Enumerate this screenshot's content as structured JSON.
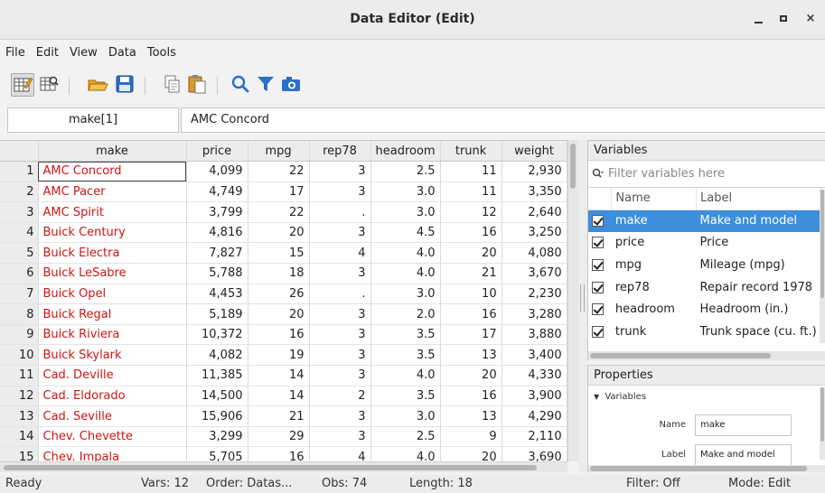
{
  "window": {
    "title": "Data Editor (Edit)"
  },
  "menu": [
    "File",
    "Edit",
    "View",
    "Data",
    "Tools"
  ],
  "toolbar": {
    "icons": [
      "edit-mode-icon",
      "browse-mode-icon",
      "open-folder-icon",
      "save-icon",
      "copy-icon",
      "paste-icon",
      "search-icon",
      "filter-icon",
      "snapshot-camera-icon"
    ]
  },
  "cell": {
    "ref": "make[1]",
    "value": "AMC Concord"
  },
  "grid": {
    "columns": [
      "make",
      "price",
      "mpg",
      "rep78",
      "headroom",
      "trunk",
      "weight"
    ],
    "rows": [
      {
        "n": "1",
        "make": "AMC Concord",
        "price": "4,099",
        "mpg": "22",
        "rep78": "3",
        "headroom": "2.5",
        "trunk": "11",
        "weight": "2,930"
      },
      {
        "n": "2",
        "make": "AMC Pacer",
        "price": "4,749",
        "mpg": "17",
        "rep78": "3",
        "headroom": "3.0",
        "trunk": "11",
        "weight": "3,350"
      },
      {
        "n": "3",
        "make": "AMC Spirit",
        "price": "3,799",
        "mpg": "22",
        "rep78": ".",
        "headroom": "3.0",
        "trunk": "12",
        "weight": "2,640"
      },
      {
        "n": "4",
        "make": "Buick Century",
        "price": "4,816",
        "mpg": "20",
        "rep78": "3",
        "headroom": "4.5",
        "trunk": "16",
        "weight": "3,250"
      },
      {
        "n": "5",
        "make": "Buick Electra",
        "price": "7,827",
        "mpg": "15",
        "rep78": "4",
        "headroom": "4.0",
        "trunk": "20",
        "weight": "4,080"
      },
      {
        "n": "6",
        "make": "Buick LeSabre",
        "price": "5,788",
        "mpg": "18",
        "rep78": "3",
        "headroom": "4.0",
        "trunk": "21",
        "weight": "3,670"
      },
      {
        "n": "7",
        "make": "Buick Opel",
        "price": "4,453",
        "mpg": "26",
        "rep78": ".",
        "headroom": "3.0",
        "trunk": "10",
        "weight": "2,230"
      },
      {
        "n": "8",
        "make": "Buick Regal",
        "price": "5,189",
        "mpg": "20",
        "rep78": "3",
        "headroom": "2.0",
        "trunk": "16",
        "weight": "3,280"
      },
      {
        "n": "9",
        "make": "Buick Riviera",
        "price": "10,372",
        "mpg": "16",
        "rep78": "3",
        "headroom": "3.5",
        "trunk": "17",
        "weight": "3,880"
      },
      {
        "n": "10",
        "make": "Buick Skylark",
        "price": "4,082",
        "mpg": "19",
        "rep78": "3",
        "headroom": "3.5",
        "trunk": "13",
        "weight": "3,400"
      },
      {
        "n": "11",
        "make": "Cad. Deville",
        "price": "11,385",
        "mpg": "14",
        "rep78": "3",
        "headroom": "4.0",
        "trunk": "20",
        "weight": "4,330"
      },
      {
        "n": "12",
        "make": "Cad. Eldorado",
        "price": "14,500",
        "mpg": "14",
        "rep78": "2",
        "headroom": "3.5",
        "trunk": "16",
        "weight": "3,900"
      },
      {
        "n": "13",
        "make": "Cad. Seville",
        "price": "15,906",
        "mpg": "21",
        "rep78": "3",
        "headroom": "3.0",
        "trunk": "13",
        "weight": "4,290"
      },
      {
        "n": "14",
        "make": "Chev. Chevette",
        "price": "3,299",
        "mpg": "29",
        "rep78": "3",
        "headroom": "2.5",
        "trunk": "9",
        "weight": "2,110"
      },
      {
        "n": "15",
        "make": "Chev. Impala",
        "price": "5,705",
        "mpg": "16",
        "rep78": "4",
        "headroom": "4.0",
        "trunk": "20",
        "weight": "3,690"
      }
    ]
  },
  "variables": {
    "title": "Variables",
    "filter_placeholder": "Filter variables here",
    "col_name": "Name",
    "col_label": "Label",
    "items": [
      {
        "name": "make",
        "label": "Make and model"
      },
      {
        "name": "price",
        "label": "Price"
      },
      {
        "name": "mpg",
        "label": "Mileage (mpg)"
      },
      {
        "name": "rep78",
        "label": "Repair record 1978"
      },
      {
        "name": "headroom",
        "label": "Headroom (in.)"
      },
      {
        "name": "trunk",
        "label": "Trunk space (cu. ft.)"
      }
    ]
  },
  "properties": {
    "title": "Properties",
    "section": "Variables",
    "name_label": "Name",
    "name_value": "make",
    "label_label": "Label",
    "label_value": "Make and model"
  },
  "status": {
    "ready": "Ready",
    "vars": "Vars: 12",
    "order": "Order: Datas...",
    "obs": "Obs: 74",
    "length": "Length: 18",
    "filter": "Filter: Off",
    "mode": "Mode: Edit"
  },
  "colors": {
    "string_text": "#d01414",
    "selection": "#3d8fdb"
  }
}
